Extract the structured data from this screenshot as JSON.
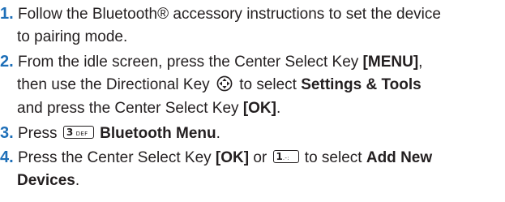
{
  "step1": {
    "number": "1.",
    "line1": " Follow the Bluetooth® accessory instructions to set the device",
    "line2": "to pairing mode."
  },
  "step2": {
    "number": "2.",
    "line1_a": " From the idle screen, press the Center Select Key ",
    "menu": "[MENU]",
    "line1_b": ",",
    "line2_a": "then use the Directional Key ",
    "line2_b": " to select ",
    "settings": "Settings & Tools",
    "line3_a": "and press the Center Select Key ",
    "ok": "[OK]",
    "line3_b": "."
  },
  "step3": {
    "number": "3.",
    "text_a": " Press ",
    "key_digit": "3",
    "key_letters": "DEF",
    "bt_menu": "Bluetooth Menu",
    "text_b": "."
  },
  "step4": {
    "number": "4.",
    "line1_a": " Press the Center Select Key ",
    "ok": "[OK]",
    "line1_b": " or ",
    "key_digit": "1",
    "key_rest": ".-:",
    "line1_c": " to select ",
    "add_new": "Add New",
    "devices": "Devices",
    "line2_b": "."
  },
  "icons": {
    "directional_key": "directional-key-icon",
    "key_3def": "key-3-def-icon",
    "key_1": "key-1-voicemail-icon"
  }
}
